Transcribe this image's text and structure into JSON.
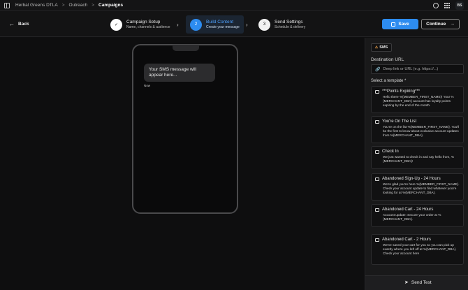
{
  "breadcrumb": {
    "items": [
      "Herbal Greens DTLA",
      "Outreach",
      "Campaigns"
    ],
    "separator": ">"
  },
  "user": {
    "initials": "BS"
  },
  "nav": {
    "back_label": "Back"
  },
  "steps": [
    {
      "number": "✓",
      "title": "Campaign Setup",
      "subtitle": "Name, channels & audience",
      "state": "done"
    },
    {
      "number": "2",
      "title": "Build Content",
      "subtitle": "Create your message",
      "state": "active"
    },
    {
      "number": "3",
      "title": "Send Settings",
      "subtitle": "Schedule & delivery",
      "state": "todo"
    }
  ],
  "actions": {
    "save_label": "Save",
    "continue_label": "Continue"
  },
  "preview": {
    "message": "Your SMS message will appear here...",
    "timestamp": "Now"
  },
  "panel": {
    "channel_tab": "SMS",
    "destination_label": "Destination URL",
    "destination_placeholder": "Deep link or URL (e.g. https://...)",
    "template_label": "Select a template *",
    "templates": [
      {
        "title": "***Points Expiring***",
        "body": "Hello there %{MEMBER_FIRST_NAME}! Your %{MERCHANT_DBA} account has loyalty points expiring by the end of the month."
      },
      {
        "title": "You're On The List",
        "body": "You're on the list %{MEMBER_FIRST_NAME}. You'll be the first to know about exclusive account updates from %{MERCHANT_DBA}."
      },
      {
        "title": "Check In",
        "body": "We just wanted to check in and say hello from, %{MERCHANT_DBA}!"
      },
      {
        "title": "Abandoned Sign-Up - 24 Hours",
        "body": "We're glad you're here %{MEMBER_FIRST_NAME}. Check your account update to find whatever you're looking for at %{MERCHANT_DBA}."
      },
      {
        "title": "Abandoned Cart - 24 Hours",
        "body": "Account update: Secure your order at %{MERCHANT_DBA}."
      },
      {
        "title": "Abandoned Cart - 2 Hours",
        "body": "We've saved your cart for you so you can pick up exactly where you left off at %{MERCHANT_DBA}. Check your account here"
      }
    ],
    "send_test_label": "Send Test"
  },
  "colors": {
    "accent": "#2d8cf0",
    "background": "#0f0f10",
    "panel": "#19191a",
    "warning": "#f0a04a"
  }
}
